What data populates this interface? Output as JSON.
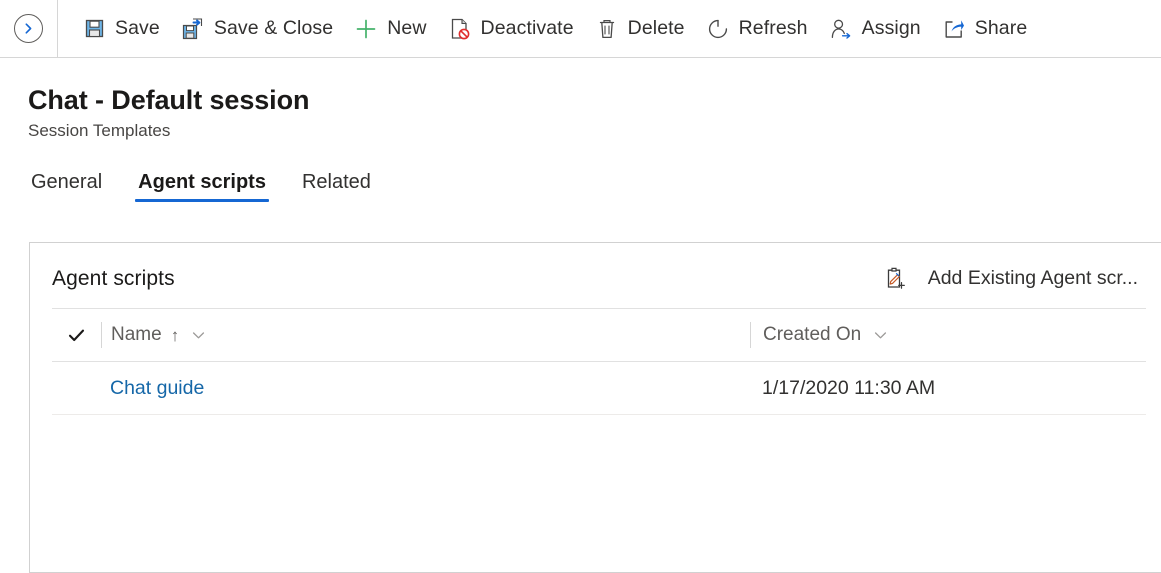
{
  "command_bar": {
    "collapse_button": {
      "name": "expand-pane-button",
      "icon": "chevron-right-circle-icon"
    },
    "items": [
      {
        "label": "Save",
        "icon": "save-icon"
      },
      {
        "label": "Save & Close",
        "icon": "save-and-close-icon"
      },
      {
        "label": "New",
        "icon": "plus-icon"
      },
      {
        "label": "Deactivate",
        "icon": "deactivate-icon"
      },
      {
        "label": "Delete",
        "icon": "trash-icon"
      },
      {
        "label": "Refresh",
        "icon": "refresh-icon"
      },
      {
        "label": "Assign",
        "icon": "assign-user-icon"
      },
      {
        "label": "Share",
        "icon": "share-icon"
      }
    ]
  },
  "header": {
    "title": "Chat - Default session",
    "subtitle": "Session Templates"
  },
  "tabs": [
    {
      "label": "General",
      "selected": false
    },
    {
      "label": "Agent scripts",
      "selected": true
    },
    {
      "label": "Related",
      "selected": false
    }
  ],
  "subgrid": {
    "title": "Agent scripts",
    "add_existing_label": "Add Existing Agent scr...",
    "add_existing_icon": "add-existing-record-icon",
    "columns": [
      {
        "label": "Name",
        "sort": "↑",
        "has_menu": true
      },
      {
        "label": "Created On",
        "sort": "",
        "has_menu": true
      }
    ],
    "rows": [
      {
        "name": "Chat guide",
        "created_on": "1/17/2020 11:30 AM"
      }
    ]
  },
  "colors": {
    "accent": "#1567d3",
    "link": "#1567a8",
    "text": "#323130",
    "muted": "#605e5c",
    "border": "#d1d1d1"
  }
}
